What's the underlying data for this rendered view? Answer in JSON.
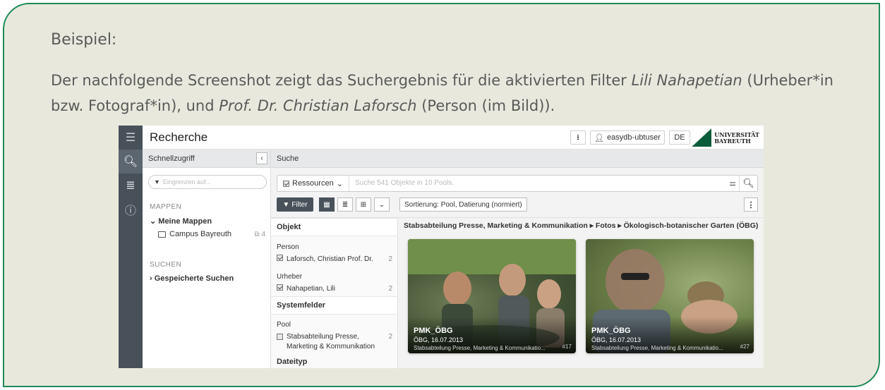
{
  "card": {
    "heading": "Beispiel:",
    "text_part1": "Der nachfolgende Screenshot zeigt das Suchergebnis für die aktivierten Filter ",
    "text_em1": "Lili Nahapetian",
    "text_part2": " (Urheber*in bzw. Fotograf*in), und ",
    "text_em2": "Prof. Dr. Christian Laforsch",
    "text_part3": " (Person (im Bild))."
  },
  "app": {
    "title": "Recherche",
    "user": "easydb-ubtuser",
    "lang": "DE",
    "logo_line1": "UNIVERSITÄT",
    "logo_line2": "BAYREUTH"
  },
  "quick": {
    "header": "Schnellzugriff",
    "filter_placeholder": "Eingrenzen auf...",
    "section_mappen": "MAPPEN",
    "meine_mappen": "Meine Mappen",
    "folder_name": "Campus Bayreuth",
    "folder_count": "4",
    "section_suchen": "SUCHEN",
    "gespeicherte": "Gespeicherte Suchen"
  },
  "search": {
    "header": "Suche",
    "resource_label": "Ressourcen",
    "placeholder": "Suche 541 Objekte in 10 Pools.",
    "filter_label": "Filter",
    "sort_label": "Sortierung: Pool, Datierung (normiert)"
  },
  "facets": {
    "objekt": "Objekt",
    "person_group": "Person",
    "person_value": "Laforsch, Christian Prof. Dr.",
    "person_count": "2",
    "urheber_group": "Urheber",
    "urheber_value": "Nahapetian, Lili",
    "urheber_count": "2",
    "systemfelder": "Systemfelder",
    "pool_group": "Pool",
    "pool_value": "Stabsabteilung Presse, Marketing & Kommunikation",
    "pool_count": "2",
    "dateityp_group": "Dateityp"
  },
  "results": {
    "breadcrumb": "Stabsabteilung Presse, Marketing & Kommunikation ▸ Fotos ▸ Ökologisch-botanischer Garten (ÖBG)",
    "tiles": [
      {
        "title": "PMK_ÖBG",
        "date": "ÖBG, 16.07.2013",
        "pool": "Stabsabteilung Presse, Marketing & Kommunikatio...",
        "id": "#17"
      },
      {
        "title": "PMK_ÖBG",
        "date": "ÖBG, 16.07.2013",
        "pool": "Stabsabteilung Presse, Marketing & Kommunikatio...",
        "id": "#27"
      }
    ]
  },
  "colors": {
    "frame": "#1f8a5a",
    "card_bg": "#e8e9dc",
    "rail": "#48515a"
  }
}
